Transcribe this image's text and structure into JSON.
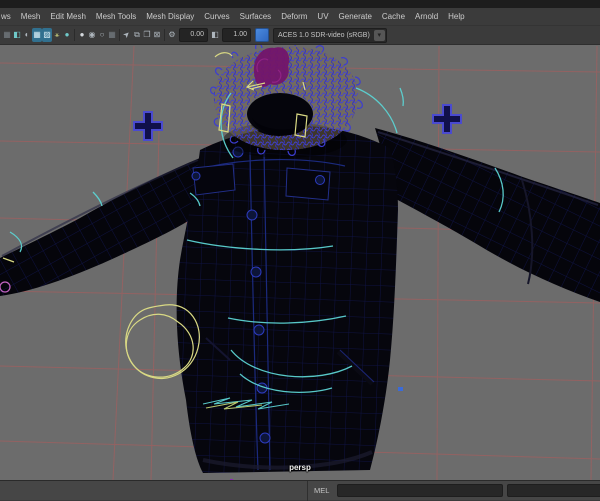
{
  "menu_bar": {
    "items": [
      "ws",
      "Mesh",
      "Edit Mesh",
      "Mesh Tools",
      "Mesh Display",
      "Curves",
      "Surfaces",
      "Deform",
      "UV",
      "Generate",
      "Cache",
      "Arnold",
      "Help"
    ]
  },
  "toolbar": {
    "icons": [
      {
        "name": "grid-toggle-icon",
        "glyph": "▦"
      },
      {
        "name": "film-gate-icon",
        "glyph": "◧"
      },
      {
        "name": "shaded-sphere-icon",
        "glyph": "◐"
      },
      {
        "name": "wireframe-on-shaded-icon",
        "glyph": "▦"
      },
      {
        "name": "textured-display-icon",
        "glyph": "▨"
      },
      {
        "name": "lighting-icon",
        "glyph": "⚹"
      },
      {
        "name": "smooth-shade-icon",
        "glyph": "●"
      },
      {
        "name": "default-material-icon",
        "glyph": "●"
      },
      {
        "name": "material-override-icon",
        "glyph": "◉"
      },
      {
        "name": "isolate-select-icon",
        "glyph": "○"
      },
      {
        "name": "xray-icon",
        "glyph": "▦"
      },
      {
        "name": "select-cursor-icon",
        "glyph": "➤"
      },
      {
        "name": "overlapping-squares-icon",
        "glyph": "⧉"
      },
      {
        "name": "folded-square-icon",
        "glyph": "❐"
      },
      {
        "name": "crossed-square-icon",
        "glyph": "⊠"
      },
      {
        "name": "gear-icon",
        "glyph": "⚙"
      },
      {
        "name": "exposure-toggle-icon",
        "glyph": "◧"
      }
    ],
    "exposure_value": "0.00",
    "gamma_value": "1.00",
    "view_transform": "ACES 1.0 SDR-video (sRGB)",
    "dropdown_arrow": "▾"
  },
  "viewport": {
    "camera_label": "persp",
    "background_color": "#6c6c6c",
    "grid_color": "#9d6060",
    "wireframe_blue": "#2531c0",
    "fur_wire_blue": "#3d3dd0",
    "fur_base_tan": "#7a6a50",
    "accent_cyan": "#5cd3d3",
    "accent_yellow": "#d9d984",
    "marker_blue_purple": "#4a4ad0",
    "selection_magenta": "#73156a"
  },
  "command_line": {
    "language_label": "MEL",
    "input_value": "",
    "result_value": ""
  }
}
